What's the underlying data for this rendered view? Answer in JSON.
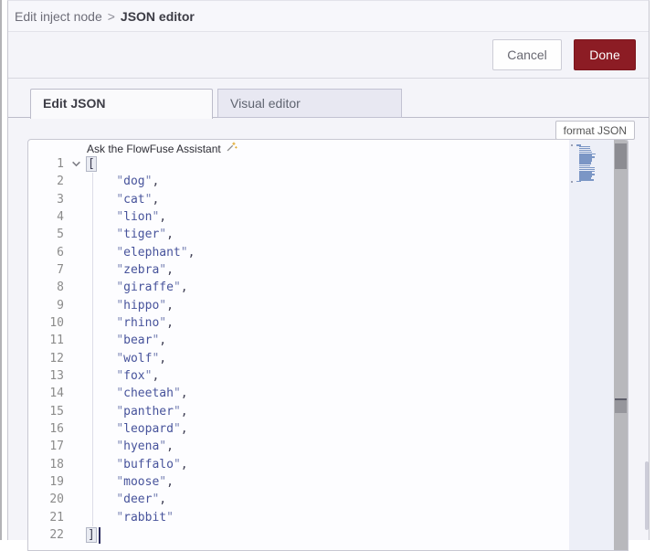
{
  "breadcrumb": {
    "parent": "Edit inject node",
    "separator": ">",
    "current": "JSON editor"
  },
  "actions": {
    "cancel_label": "Cancel",
    "done_label": "Done"
  },
  "tabs": {
    "edit_json": "Edit JSON",
    "visual_editor": "Visual editor"
  },
  "toolbar": {
    "format_label": "format JSON"
  },
  "editor": {
    "assistant_hint": "Ask the FlowFuse Assistant",
    "language": "json",
    "open_bracket": "[",
    "close_bracket": "]",
    "indent": "    ",
    "quote": "\"",
    "comma": ",",
    "line_count": 22,
    "items": [
      "dog",
      "cat",
      "lion",
      "tiger",
      "elephant",
      "zebra",
      "giraffe",
      "hippo",
      "rhino",
      "bear",
      "wolf",
      "fox",
      "cheetah",
      "panther",
      "leopard",
      "hyena",
      "buffalo",
      "moose",
      "deer",
      "rabbit"
    ],
    "cursor_line": 22
  },
  "colors": {
    "accent_red": "#8c1c24",
    "string_blue": "#47539b",
    "minimap_mark_blue": "#7b96c5",
    "chrome_bg": "#f4f4f9",
    "inactive_tab_bg": "#e8e8f2"
  }
}
